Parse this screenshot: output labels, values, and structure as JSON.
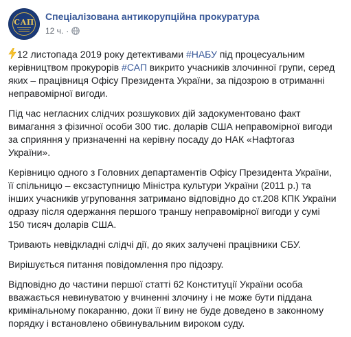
{
  "post": {
    "page_name": "Спеціалізована антикорупційна прокуратура",
    "avatar_text": "САП",
    "time": "12 ч.",
    "meta_separator": "·",
    "icons": {
      "emoji": "lightning-bolt-icon",
      "audience": "globe-icon"
    },
    "colors": {
      "link": "#385898",
      "text": "#1c1e21",
      "meta": "#616770",
      "avatar_bg": "#1b3a78",
      "avatar_gold": "#e8c65a"
    },
    "p1": {
      "t1": "12 листопада 2019 року детективами ",
      "h1": "#НАБУ",
      "t2": " під процесуальним керівництвом прокурорів ",
      "h2": "#САП",
      "t3": " викрито учасників злочинної групи, серед яких – працівниця Офісу Президента України, за підозрою в отриманні неправомірної вигоди."
    },
    "p2": "Під час негласних слідчих розшукових дій задокументовано факт вимагання з фізичної особи 300 тис. доларів США неправомірної вигоди за сприяння у призначенні на керівну посаду до НАК «Нафтогаз України».",
    "p3": "Керівницю одного з Головних департаментів Офісу Президента України, її спільницю – екс­заступницю Міністра культури України (2011 р.) та інших учасників угруповання затримано відповідно до ст.208 КПК України одразу після одержання першого траншу неправомірної вигоди у сумі 150 тисяч доларів США.",
    "p4": "Тривають невідкладні слідчі дії, до яких залучені працівники СБУ.",
    "p5": "Вирішується питання повідомлення про підозру.",
    "p6": "Відповідно до частини першої статті 62 Конституції України особа вважається невинуватою у вчиненні злочину і не може бути піддана кримінальному покаранню, доки її вину не буде доведено в законному порядку і встановлено обвинувальним вироком суду."
  }
}
